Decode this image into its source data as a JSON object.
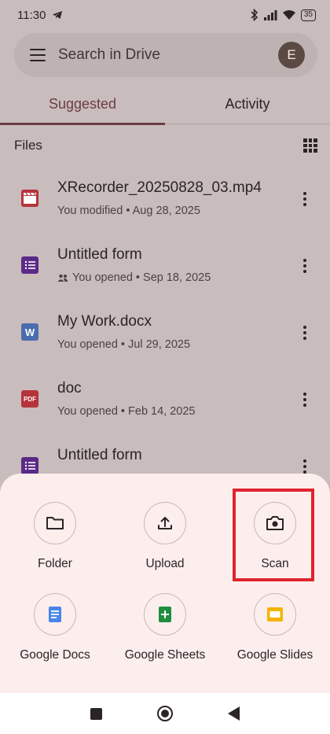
{
  "status_bar": {
    "time": "11:30",
    "battery": "35"
  },
  "search": {
    "placeholder": "Search in Drive",
    "avatar_initial": "E"
  },
  "tabs": [
    {
      "label": "Suggested"
    },
    {
      "label": "Activity"
    }
  ],
  "files_section": {
    "title": "Files"
  },
  "files": [
    {
      "name": "XRecorder_20250828_03.mp4",
      "meta": "You modified • Aug 28, 2025",
      "type": "video",
      "shared": false,
      "icon_text": ""
    },
    {
      "name": "Untitled form",
      "meta": "You opened • Sep 18, 2025",
      "type": "form",
      "shared": true,
      "icon_text": ""
    },
    {
      "name": "My Work.docx",
      "meta": "You opened • Jul 29, 2025",
      "type": "word",
      "shared": false,
      "icon_text": "W"
    },
    {
      "name": "doc",
      "meta": "You opened • Feb 14, 2025",
      "type": "pdf",
      "shared": false,
      "icon_text": "PDF"
    },
    {
      "name": "Untitled form",
      "meta": "",
      "type": "form",
      "shared": false,
      "icon_text": ""
    }
  ],
  "actions": [
    {
      "label": "Folder"
    },
    {
      "label": "Upload"
    },
    {
      "label": "Scan"
    },
    {
      "label": "Google Docs"
    },
    {
      "label": "Google Sheets"
    },
    {
      "label": "Google Slides"
    }
  ],
  "colors": {
    "accent": "#6c3d43",
    "highlight": "#e0242e",
    "sheet_bg": "#fdeeee",
    "docs": "#4a86e8",
    "sheets": "#1e8e3e",
    "slides": "#f4b400"
  }
}
